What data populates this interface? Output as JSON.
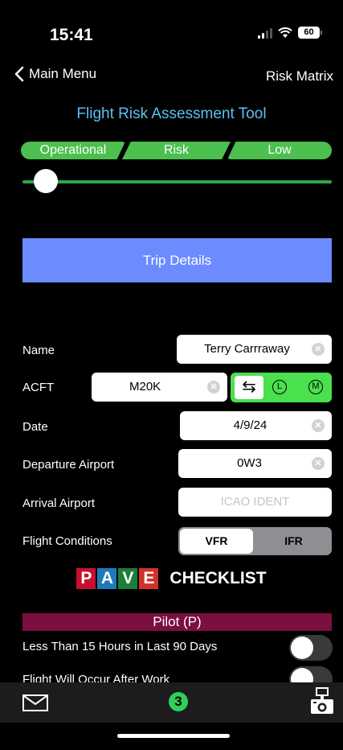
{
  "status": {
    "time": "15:41",
    "battery": "60"
  },
  "nav": {
    "back_label": "Main Menu",
    "right_label": "Risk Matrix"
  },
  "app_title": "Flight Risk Assessment Tool",
  "risk_bar": {
    "segments": [
      "Operational",
      "Risk",
      "Low"
    ],
    "color": "#4cc04e",
    "slider_level": 0.07
  },
  "trip_button": "Trip Details",
  "form": {
    "name": {
      "label": "Name",
      "value": "Terry Carrraway"
    },
    "acft": {
      "label": "ACFT",
      "value": "M20K",
      "toggle_left": "L",
      "toggle_right": "M"
    },
    "date": {
      "label": "Date",
      "value": "4/9/24"
    },
    "departure": {
      "label": "Departure Airport",
      "value": "0W3"
    },
    "arrival": {
      "label": "Arrival Airport",
      "placeholder": "ICAO IDENT"
    },
    "conditions": {
      "label": "Flight Conditions",
      "options": [
        "VFR",
        "IFR"
      ],
      "selected": "VFR"
    }
  },
  "pave": {
    "letters": [
      "P",
      "A",
      "V",
      "E"
    ],
    "letter_colors": [
      "#c8102e",
      "#1e7ab8",
      "#1b7d3a",
      "#d0312d"
    ],
    "title": "CHECKLIST"
  },
  "pilot_section": {
    "title": "Pilot (P)",
    "items": [
      {
        "label": "Less Than 15 Hours in Last 90 Days",
        "on": false
      },
      {
        "label": "Flight Will Occur After Work",
        "on": false
      }
    ]
  },
  "tab_bar": {
    "badge_count": "3",
    "icons": [
      "mail-icon",
      "camera-icon"
    ]
  }
}
